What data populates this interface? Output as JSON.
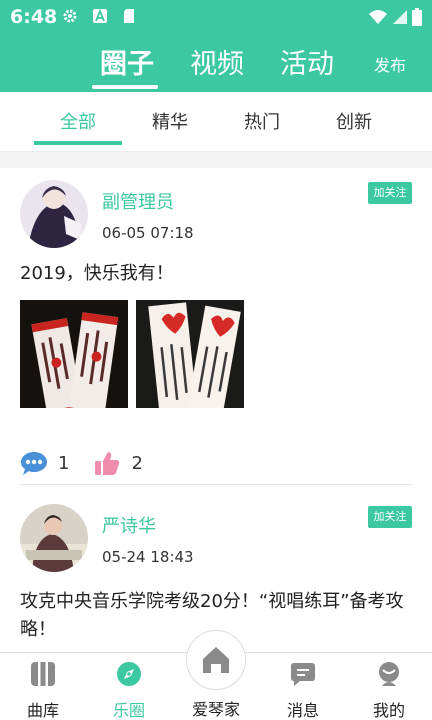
{
  "status_bar": {
    "time": "6:48"
  },
  "header": {
    "tabs": [
      {
        "label": "圈子",
        "active": true
      },
      {
        "label": "视频",
        "active": false
      },
      {
        "label": "活动",
        "active": false
      }
    ],
    "publish_label": "发布"
  },
  "sub_tabs": [
    {
      "label": "全部",
      "active": true
    },
    {
      "label": "精华",
      "active": false
    },
    {
      "label": "热门",
      "active": false
    },
    {
      "label": "创新",
      "active": false
    }
  ],
  "posts": [
    {
      "username": "副管理员",
      "timestamp": "06-05 07:18",
      "follow_label": "加关注",
      "content": "2019，快乐我有！",
      "comments": "1",
      "likes": "2"
    },
    {
      "username": "严诗华",
      "timestamp": "05-24 18:43",
      "follow_label": "加关注",
      "content": "攻克中央音乐学院考级20分！“视唱练耳”备考攻略！"
    }
  ],
  "bottom_nav": [
    {
      "label": "曲库",
      "icon": "piano-keys-icon",
      "active": false
    },
    {
      "label": "乐圈",
      "icon": "compass-icon",
      "active": true
    },
    {
      "label": "爱琴家",
      "icon": "home-icon",
      "active": false
    },
    {
      "label": "消息",
      "icon": "message-icon",
      "active": false
    },
    {
      "label": "我的",
      "icon": "profile-icon",
      "active": false
    }
  ],
  "colors": {
    "accent": "#3cc8a0",
    "like": "#f08cac",
    "comment": "#4a90d9"
  }
}
